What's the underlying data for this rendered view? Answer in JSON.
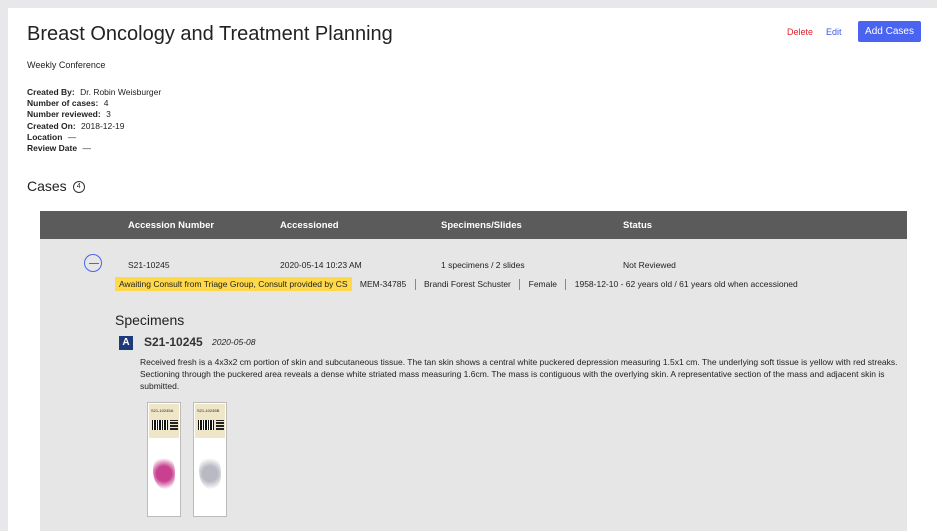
{
  "header": {
    "title": "Breast Oncology and Treatment Planning",
    "subtitle": "Weekly Conference",
    "delete_label": "Delete",
    "edit_label": "Edit",
    "add_cases_label": "Add Cases"
  },
  "meta": {
    "created_by": {
      "label": "Created By:",
      "value": "Dr. Robin Weisburger"
    },
    "num_cases": {
      "label": "Number of cases:",
      "value": "4"
    },
    "num_reviewed": {
      "label": "Number reviewed:",
      "value": "3"
    },
    "created_on": {
      "label": "Created On:",
      "value": "2018-12-19"
    },
    "location": {
      "label": "Location",
      "value": "—"
    },
    "review_date": {
      "label": "Review Date",
      "value": "—"
    }
  },
  "cases": {
    "heading": "Cases",
    "count": "4",
    "columns": [
      "Accession Number",
      "Accessioned",
      "Specimens/Slides",
      "Status"
    ],
    "rows": [
      {
        "accession": "S21-10245",
        "accessioned": "2020-05-14 10:23 AM",
        "specimens_slides": "1 specimens / 2 slides",
        "status": "Not Reviewed",
        "consult_tag": "Awaiting Consult from Triage Group, Consult provided by CS",
        "mrn": "MEM-34785",
        "patient": "Brandi Forest Schuster",
        "sex": "Female",
        "dob_age": "1958-12-10 - 62 years old / 61 years old when accessioned",
        "specimens_heading": "Specimens",
        "specimen": {
          "letter": "A",
          "accession": "S21-10245",
          "date": "2020-05-08",
          "description": "Received fresh is a 4x3x2 cm portion of skin and subcutaneous tissue. The tan skin shows a central white puckered depression measuring 1.5x1 cm. The underlying soft tissue is yellow with red streaks. Sectioning through the puckered area reveals a dense white striated mass measuring 1.6cm. The mass is contiguous with the overlying skin. A representative section of the mass and adjacent skin is submitted.",
          "slides": [
            {
              "label": "S21-10245A",
              "stain_color": "#c8408f"
            },
            {
              "label": "S21-10245B",
              "stain_color": "#b9b9c4"
            }
          ]
        }
      }
    ]
  },
  "colors": {
    "accent": "#4a63f0",
    "delete": "#e0202a",
    "table_header": "#5b5b5b",
    "tag": "#ffd94a",
    "specimen_letter": "#1f3a7a"
  }
}
